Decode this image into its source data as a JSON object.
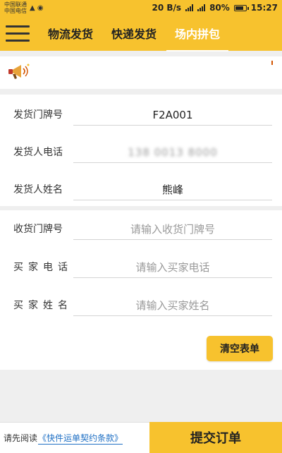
{
  "status_bar": {
    "carrier_1": "中国联通",
    "carrier_2": "中国电信",
    "network_speed": "20 B/s",
    "battery": "80%",
    "battery_fraction": 0.8,
    "time": "15:27"
  },
  "app_bar": {
    "tabs": [
      {
        "label": "物流发货",
        "active": false
      },
      {
        "label": "快递发货",
        "active": false
      },
      {
        "label": "场内拼包",
        "active": true
      }
    ]
  },
  "sender": {
    "store_label": "发货门牌号",
    "store_value": "F2A001",
    "phone_label": "发货人电话",
    "phone_value": "138 0013 8000",
    "name_label": "发货人姓名",
    "name_value": "熊峰"
  },
  "receiver": {
    "store_label": "收货门牌号",
    "store_placeholder": "请输入收货门牌号",
    "phone_label": "买家电话",
    "phone_placeholder": "请输入买家电话",
    "name_label": "买家姓名",
    "name_placeholder": "请输入买家姓名"
  },
  "actions": {
    "clear_label": "清空表单",
    "submit_label": "提交订单"
  },
  "footer": {
    "read_prefix": "请先阅读",
    "contract_link": "《快件运单契约条款》"
  },
  "colors": {
    "brand_yellow": "#f7c22e",
    "link_blue": "#1e6fc4"
  }
}
